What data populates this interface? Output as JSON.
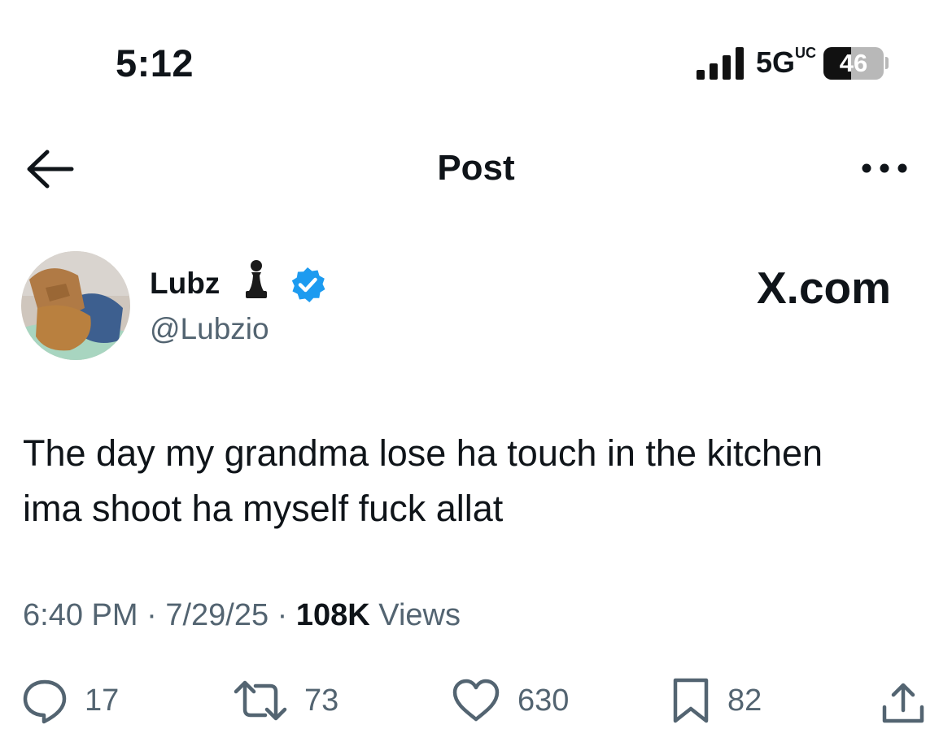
{
  "status_bar": {
    "time": "5:12",
    "network": "5G",
    "network_suffix": "UC",
    "battery": "46",
    "battery_level": 0.46
  },
  "header": {
    "title": "Post"
  },
  "author": {
    "name": "Lubz",
    "handle": "@Lubzio",
    "name_emoji": "pawn-icon",
    "verified": true
  },
  "watermark": "X.com",
  "tweet": {
    "text": "The day my grandma lose ha touch in the kitchen\nima shoot ha myself fuck allat",
    "time": "6:40 PM",
    "separator": "·",
    "date": "7/29/25",
    "views_count": "108K",
    "views_label": "Views"
  },
  "actions": {
    "replies": "17",
    "reposts": "73",
    "likes": "630",
    "bookmarks": "82"
  },
  "colors": {
    "text": "#0f1419",
    "secondary": "#536471",
    "verified": "#1d9bf0"
  }
}
